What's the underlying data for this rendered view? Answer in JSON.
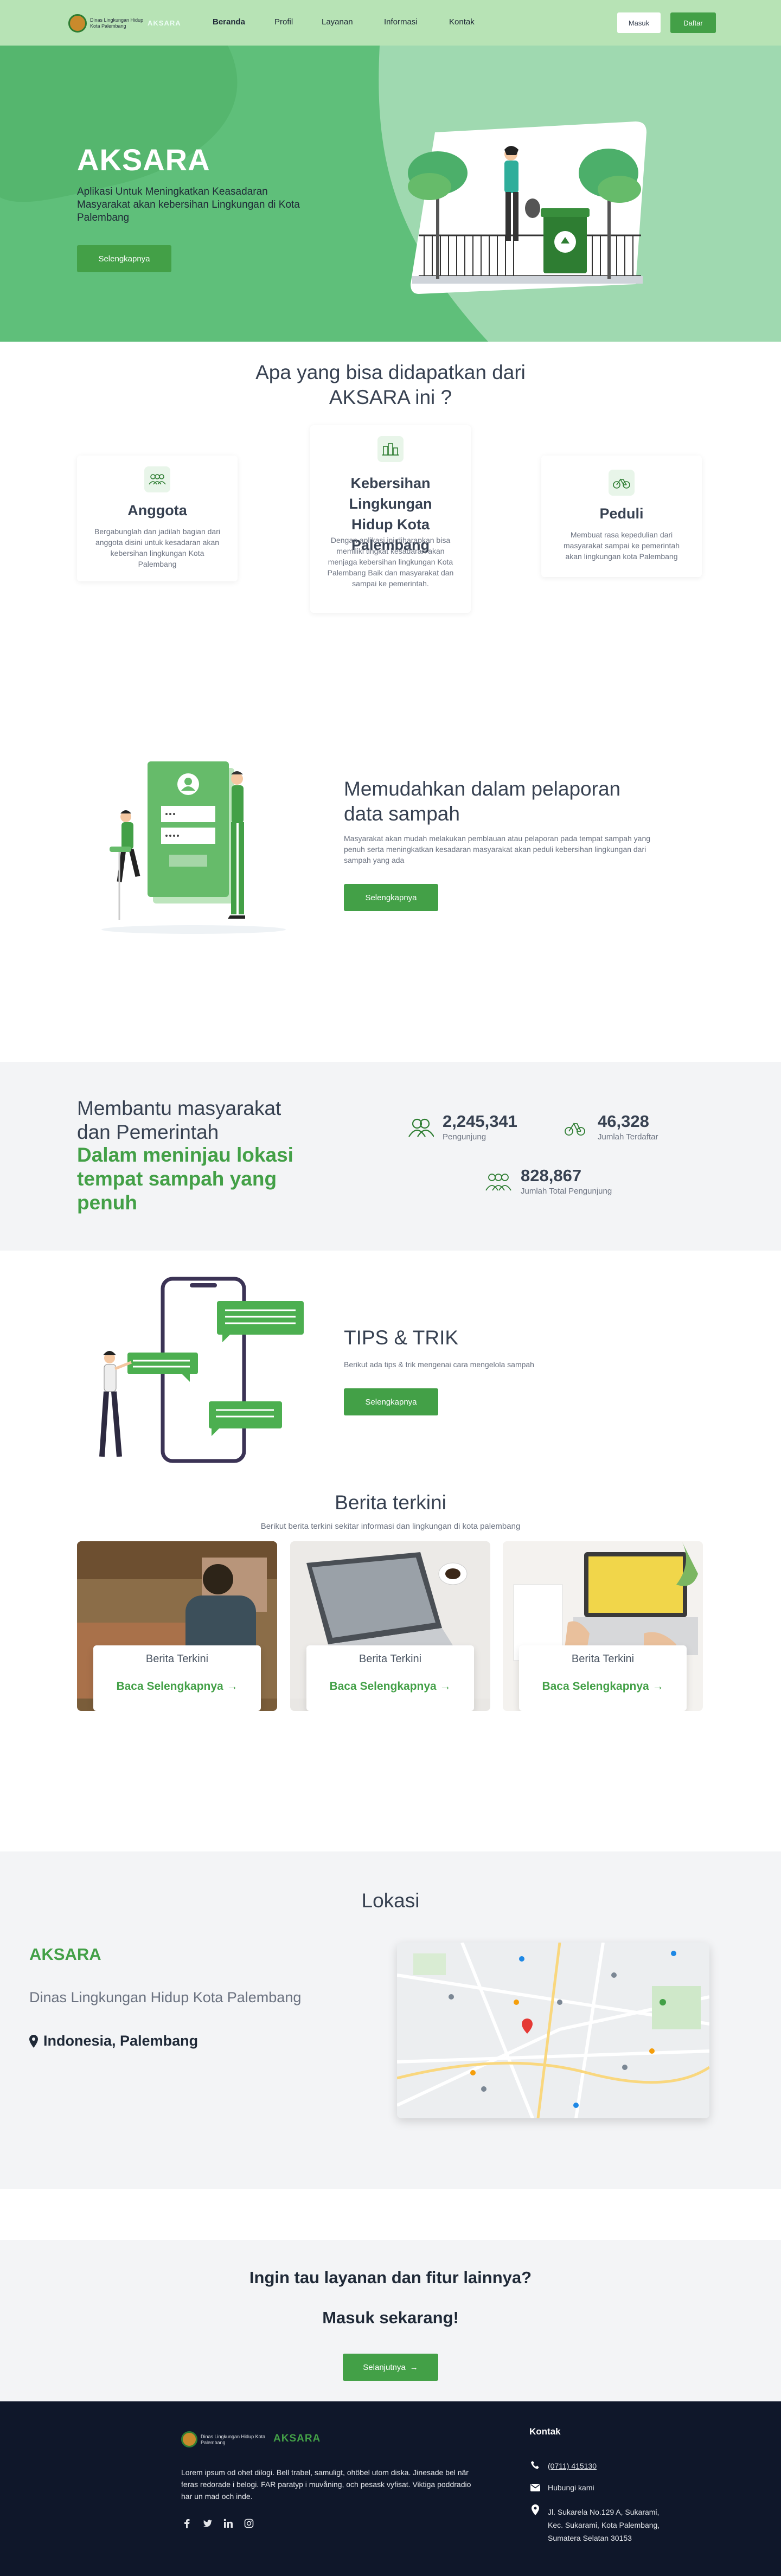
{
  "nav": {
    "logo_text": "Dinas Lingkungan Hidup Kota Palembang",
    "brand": "AKSARA",
    "links": [
      "Beranda",
      "Profil",
      "Layanan",
      "Informasi",
      "Kontak"
    ],
    "login": "Masuk",
    "register": "Daftar"
  },
  "hero": {
    "title": "AKSARA",
    "subtitle": "Aplikasi Untuk Meningkatkan Keasadaran Masyarakat akan kebersihan Lingkungan di Kota Palembang",
    "cta": "Selengkapnya"
  },
  "features": {
    "heading": "Apa yang bisa didapatkan dari AKSARA ini ?",
    "cards": [
      {
        "icon": "people-group-icon",
        "title": "Anggota",
        "desc": "Bergabunglah dan jadilah bagian dari anggota disini untuk kesadaran akan kebersihan lingkungan Kota Palembang"
      },
      {
        "icon": "city-buildings-icon",
        "title": "Kebersihan Lingkungan Hidup Kota Palembang",
        "desc": "Dengan aplikasi ini  diharapkan bisa memiliki tingkat kesadaran akan menjaga kebersihan lingkungan Kota Palembang Baik dan masyarakat dan sampai ke pemerintah."
      },
      {
        "icon": "bicycle-icon",
        "title": "Peduli",
        "desc": "Membuat rasa kepedulian dari masyarakat sampai ke pemerintah akan lingkungan kota Palembang"
      }
    ]
  },
  "report": {
    "title": "Memudahkan dalam pelaporan data sampah",
    "desc": "Masyarakat akan mudah melakukan pemblauan atau pelaporan pada tempat sampah yang penuh serta meningkatkan kesadaran masyarakat akan peduli kebersihan lingkungan dari sampah yang ada",
    "cta": "Selengkapnya"
  },
  "stats": {
    "heading": "Membantu masyarakat dan Pemerintah",
    "highlight": "Dalam meninjau lokasi tempat sampah yang penuh",
    "items": [
      {
        "icon": "users-icon",
        "value": "2,245,341",
        "label": "Pengunjung"
      },
      {
        "icon": "bicycle-icon",
        "value": "46,328",
        "label": "Jumlah Terdaftar"
      },
      {
        "icon": "people-group-icon",
        "value": "828,867",
        "label": "Jumlah Total Pengunjung"
      }
    ]
  },
  "tips": {
    "title": "TIPS & TRIK",
    "desc": "Berikut ada tips & trik mengenai cara mengelola sampah",
    "cta": "Selengkapnya"
  },
  "news": {
    "heading": "Berita terkini",
    "subheading": "Berikut berita terkini sekitar informasi dan lingkungan di kota palembang",
    "cards": [
      {
        "title": "Berita Terkini",
        "link": "Baca Selengkapnya"
      },
      {
        "title": "Berita Terkini",
        "link": "Baca Selengkapnya"
      },
      {
        "title": "Berita Terkini",
        "link": "Baca Selengkapnya"
      }
    ]
  },
  "location": {
    "heading": "Lokasi",
    "brand": "AKSARA",
    "agency": "Dinas Lingkungan Hidup Kota Palembang",
    "place": "Indonesia, Palembang"
  },
  "cta": {
    "line1": "Ingin tau layanan dan fitur lainnya?",
    "line2": "Masuk sekarang!",
    "button": "Selanjutnya"
  },
  "footer": {
    "logo_text": "Dinas Lingkungan Hidup Kota Palembang",
    "brand": "AKSARA",
    "about": "Lorem ipsum od ohet dilogi. Bell trabel, samuligt, ohöbel utom diska. Jinesade bel när feras redorade i belogi. FAR paratyp i muvåning, och pesask vyfisat. Viktiga poddradio har un mad och inde.",
    "contact_heading": "Kontak",
    "phone": "(0711) 415130",
    "email": "Hubungi kami",
    "address": "Jl. Sukarela No.129 A, Sukarami, Kec. Sukarami, Kota Palembang, Sumatera Selatan 30153",
    "social": [
      "facebook-icon",
      "twitter-icon",
      "linkedin-icon",
      "instagram-icon"
    ]
  },
  "colors": {
    "green": "#43a047",
    "dark_navy": "#0f172a",
    "light_green": "#b7e3b5"
  }
}
